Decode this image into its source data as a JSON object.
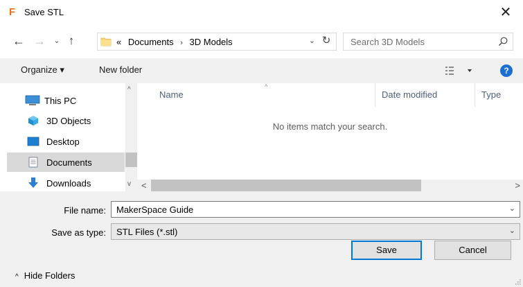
{
  "window": {
    "title": "Save STL",
    "app_icon_letter": "F",
    "close_glyph": "✕"
  },
  "navigation": {
    "back_glyph": "←",
    "forward_glyph": "→",
    "recent_glyph": "⌄",
    "up_glyph": "↑",
    "breadcrumb": {
      "overflow": "«",
      "items": [
        "Documents",
        "3D Models"
      ],
      "separator": "›"
    },
    "dropdown_glyph": "⌄",
    "refresh_glyph": "↻"
  },
  "search": {
    "placeholder": "Search 3D Models",
    "value": ""
  },
  "toolbar": {
    "organize_label": "Organize ▾",
    "new_folder_label": "New folder",
    "help_label": "?"
  },
  "sidebar": {
    "items": [
      {
        "label": "This PC",
        "icon": "computer-icon"
      },
      {
        "label": "3D Objects",
        "icon": "cube-icon"
      },
      {
        "label": "Desktop",
        "icon": "desktop-icon"
      },
      {
        "label": "Documents",
        "icon": "document-icon",
        "selected": true
      },
      {
        "label": "Downloads",
        "icon": "download-icon"
      }
    ],
    "scroll_up_glyph": "^",
    "scroll_down_glyph": "v"
  },
  "file_list": {
    "columns": [
      "Name",
      "Date modified",
      "Type"
    ],
    "sort_indicator": "^",
    "empty_message": "No items match your search.",
    "scroll_left_glyph": "<",
    "scroll_right_glyph": ">"
  },
  "form": {
    "file_name_label": "File name:",
    "file_name_value": "MakerSpace Guide",
    "save_as_type_label": "Save as type:",
    "save_as_type_value": "STL Files (*.stl)",
    "dropdown_glyph": "⌄"
  },
  "footer": {
    "hide_folders_label": "Hide Folders",
    "hide_folders_caret": "^",
    "save_label": "Save",
    "cancel_label": "Cancel"
  },
  "colors": {
    "accent": "#0078d7",
    "toolbar_bg": "#f0f0f0",
    "selected_item_bg": "#d9d9d9",
    "column_header": "#4c607a",
    "app_icon": "#e8711b",
    "help_icon": "#1c6fd1"
  }
}
